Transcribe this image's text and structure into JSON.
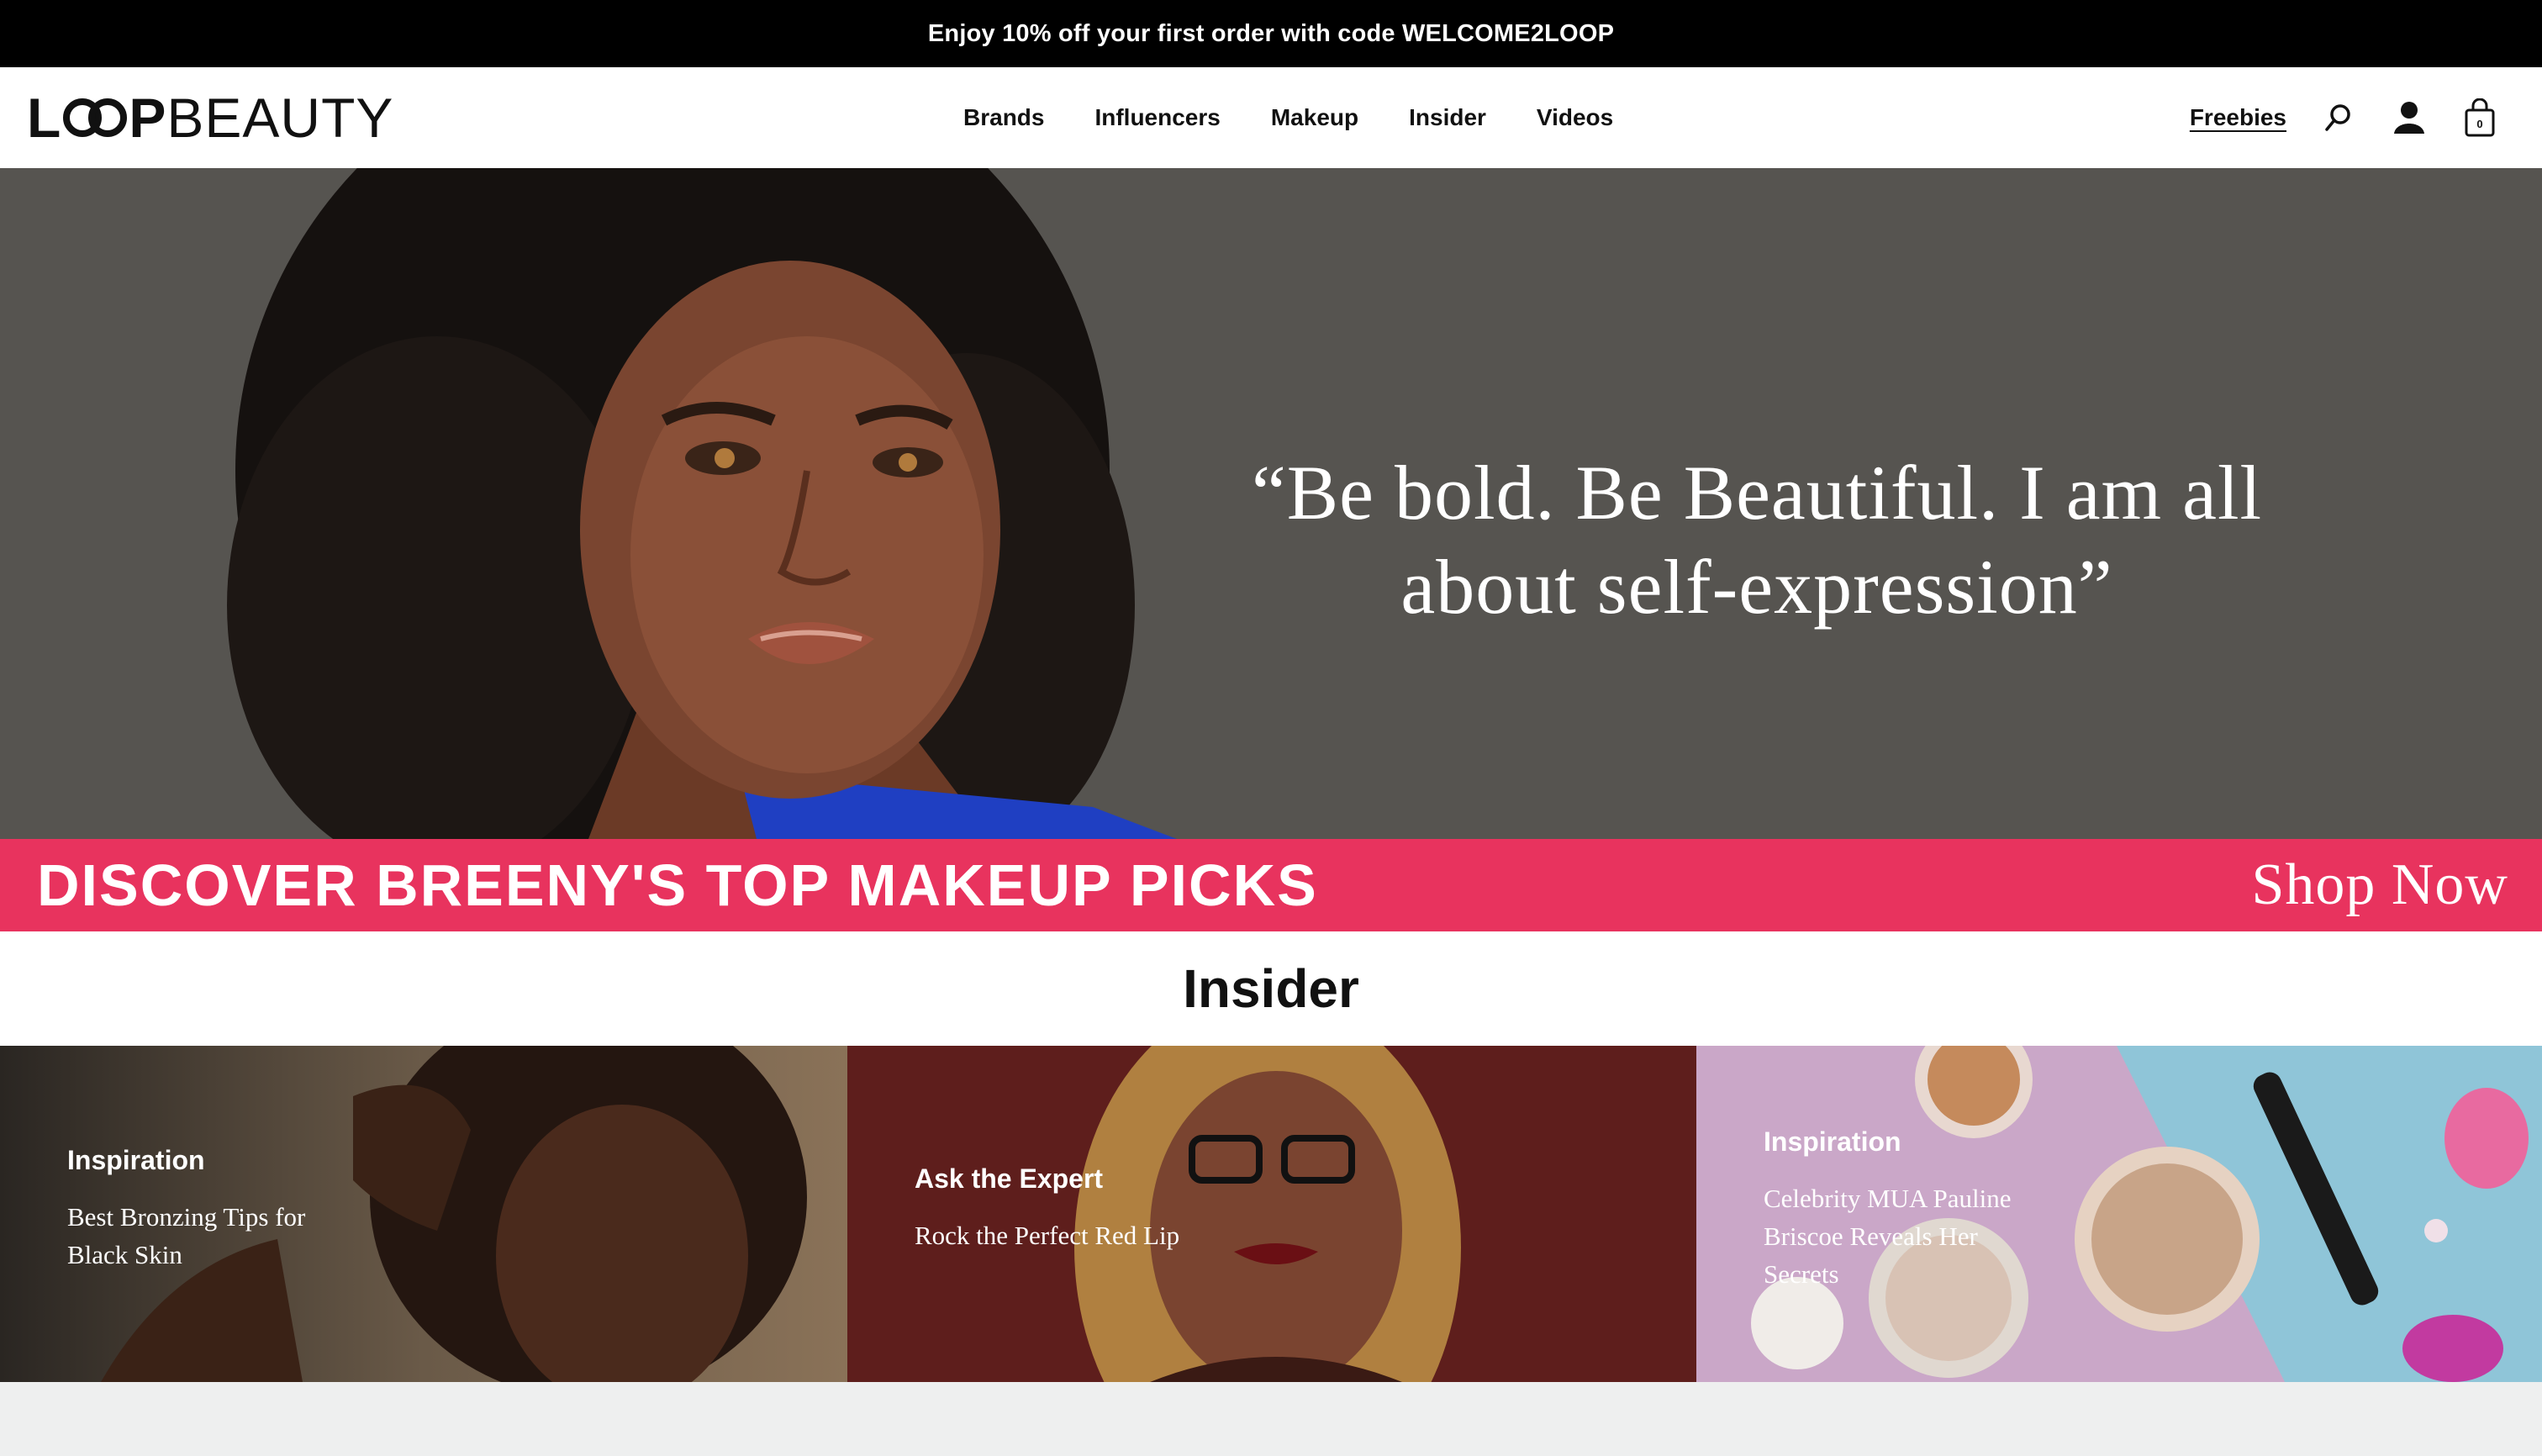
{
  "promo": {
    "text": "Enjoy 10% off your first order with code WELCOME2LOOP"
  },
  "header": {
    "logo": {
      "part1": "L",
      "part2": "P",
      "part3": "BEAUTY"
    },
    "nav": [
      "Brands",
      "Influencers",
      "Makeup",
      "Insider",
      "Videos"
    ],
    "freebies": "Freebies",
    "cart_count": "0",
    "icons": [
      "search-icon",
      "account-icon",
      "bag-icon"
    ]
  },
  "hero": {
    "quote_line1": "“Be bold. Be Beautiful. I am all",
    "quote_line2": "about self-expression”",
    "cta_title": "DISCOVER BREENY'S TOP MAKEUP PICKS",
    "cta_link": "Shop Now"
  },
  "insider": {
    "heading": "Insider",
    "cards": [
      {
        "category": "Inspiration",
        "title_line1": "Best Bronzing Tips for",
        "title_line2": "Black Skin",
        "title_line3": ""
      },
      {
        "category": "Ask the Expert",
        "title_line1": "Rock the Perfect Red Lip",
        "title_line2": "",
        "title_line3": ""
      },
      {
        "category": "Inspiration",
        "title_line1": "Celebrity MUA Pauline",
        "title_line2": "Briscoe Reveals Her",
        "title_line3": "Secrets"
      }
    ]
  },
  "colors": {
    "accent": "#e8335e",
    "hero_bg": "#565450",
    "promo_bg": "#000000"
  }
}
